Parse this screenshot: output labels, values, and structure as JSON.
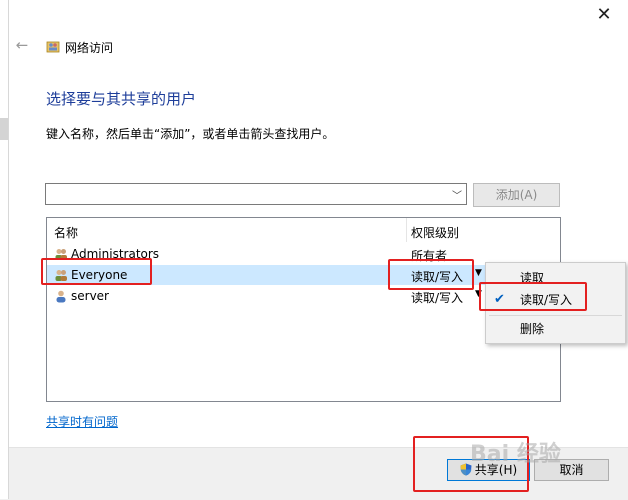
{
  "window": {
    "title": "网络访问",
    "close_label": "✕"
  },
  "heading": "选择要与其共享的用户",
  "instructions": "键入名称，然后单击“添加”，或者单击箭头查找用户。",
  "user_combo": {
    "value": ""
  },
  "add_button": "添加(A)",
  "user_list": {
    "columns": [
      "名称",
      "权限级别"
    ],
    "rows": [
      {
        "name": "Administrators",
        "permission": "所有者",
        "icon": "group-icon"
      },
      {
        "name": "Everyone",
        "permission": "读取/写入",
        "icon": "group-icon",
        "selected": true
      },
      {
        "name": "server",
        "permission": "读取/写入",
        "icon": "user-icon"
      }
    ]
  },
  "context_menu": {
    "items": [
      {
        "label": "读取",
        "checked": false
      },
      {
        "label": "读取/写入",
        "checked": true
      },
      {
        "label": "删除",
        "checked": false
      }
    ]
  },
  "help_link": "共享时有问题",
  "share_button": "共享(H)",
  "cancel_button": "取消",
  "watermark": "Bai 经验",
  "colors": {
    "heading": "#1e3e9a",
    "link": "#0066cc",
    "selection": "#cce8ff",
    "annotation": "#e32020"
  }
}
